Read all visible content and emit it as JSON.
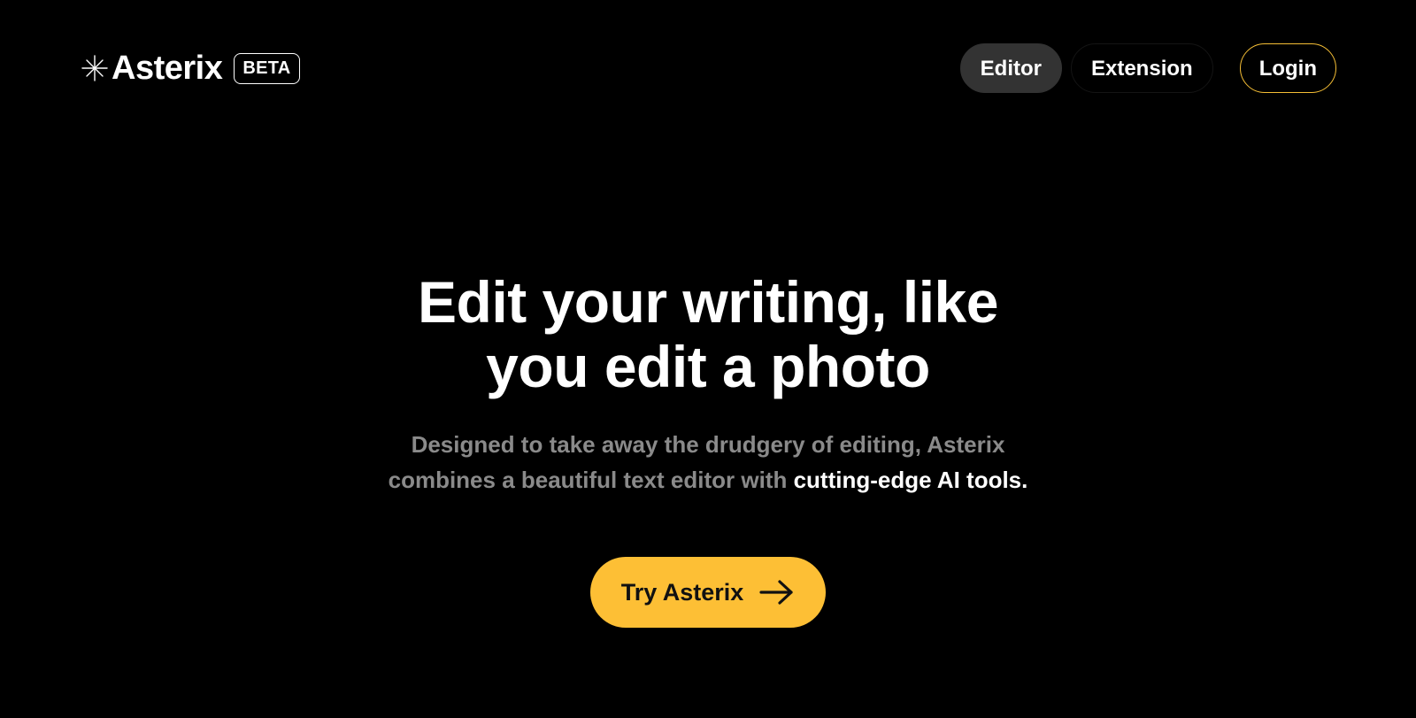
{
  "header": {
    "brand_name": "Asterix",
    "brand_icon": "asterisk-sparkle-icon",
    "badge": "BETA",
    "nav": {
      "editor": "Editor",
      "extension": "Extension",
      "login": "Login"
    }
  },
  "hero": {
    "headline_line1": "Edit your writing, like",
    "headline_line2": "you edit a photo",
    "subhead_line1": "Designed to take away the drudgery of editing, Asterix",
    "subhead_line2_plain": "combines a beautiful text editor with ",
    "subhead_line2_highlight": "cutting-edge AI tools.",
    "cta_label": "Try Asterix",
    "cta_icon": "arrow-right-icon"
  },
  "colors": {
    "background": "#000000",
    "accent": "#fdbf35",
    "active_nav": "#333333",
    "muted_text": "#8a8a8a"
  }
}
